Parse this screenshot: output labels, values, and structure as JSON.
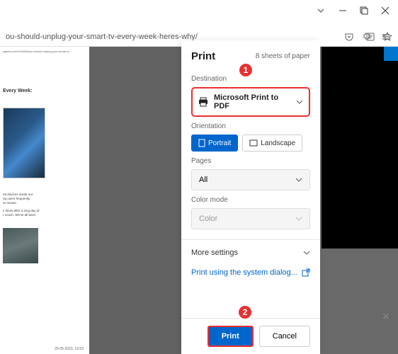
{
  "window": {
    "url_fragment": "ou-should-unplug-your-smart-tv-every-week-heres-why/"
  },
  "preview": {
    "tiny_url": "wgeek.com/154485/you-should-unplug-your-smart-tv...",
    "heading": "Every Week:",
    "body_text": "ed devices inside our\nng users frequently\nce issues.\n\ne show after a long day at\nr couch. We've all been",
    "date": "25-05-2023, 12:53"
  },
  "print": {
    "title": "Print",
    "sheets": "8 sheets of paper",
    "dest_label": "Destination",
    "dest_value": "Microsoft Print to PDF",
    "orient_label": "Orientation",
    "orient_portrait": "Portrait",
    "orient_landscape": "Landscape",
    "pages_label": "Pages",
    "pages_value": "All",
    "color_label": "Color mode",
    "color_value": "Color",
    "more": "More settings",
    "system_dialog": "Print using the system dialog...",
    "print_btn": "Print",
    "cancel_btn": "Cancel"
  },
  "callouts": {
    "one": "1",
    "two": "2"
  }
}
